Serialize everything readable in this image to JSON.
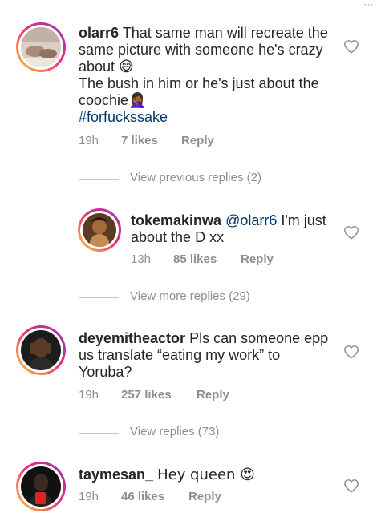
{
  "comments": [
    {
      "username": "olarr6",
      "text": "That same man will recreate the same picture with someone he's crazy about 😅",
      "text_line2": "The bush in him or he's just about the coochie🤦🏾‍♀️",
      "hashtag": "#forfuckssake",
      "time": "19h",
      "likes": "7 likes",
      "reply_label": "Reply"
    },
    {
      "username": "tokemakinwa",
      "mention": "@olarr6",
      "text": " I'm just about the D xx",
      "time": "13h",
      "likes": "85 likes",
      "reply_label": "Reply"
    },
    {
      "username": "deyemitheactor",
      "text": "Pls can someone epp us translate “eating my work” to Yoruba?",
      "time": "19h",
      "likes": "257 likes",
      "reply_label": "Reply"
    },
    {
      "username": "taymesan_",
      "text": "Hey queen 😍",
      "time": "19h",
      "likes": "46 likes",
      "reply_label": "Reply"
    }
  ],
  "reply_toggles": {
    "previous": "View previous replies (2)",
    "more": "View more replies (29)",
    "view": "View replies (73)"
  },
  "icons": {
    "like": "heart-outline-icon",
    "menu": "more-dots-icon"
  },
  "colors": {
    "text": "#262626",
    "meta": "#8e8e8e",
    "hashtag": "#00376b",
    "ring_start": "#f9ce34",
    "ring_end": "#8a3ab9"
  }
}
